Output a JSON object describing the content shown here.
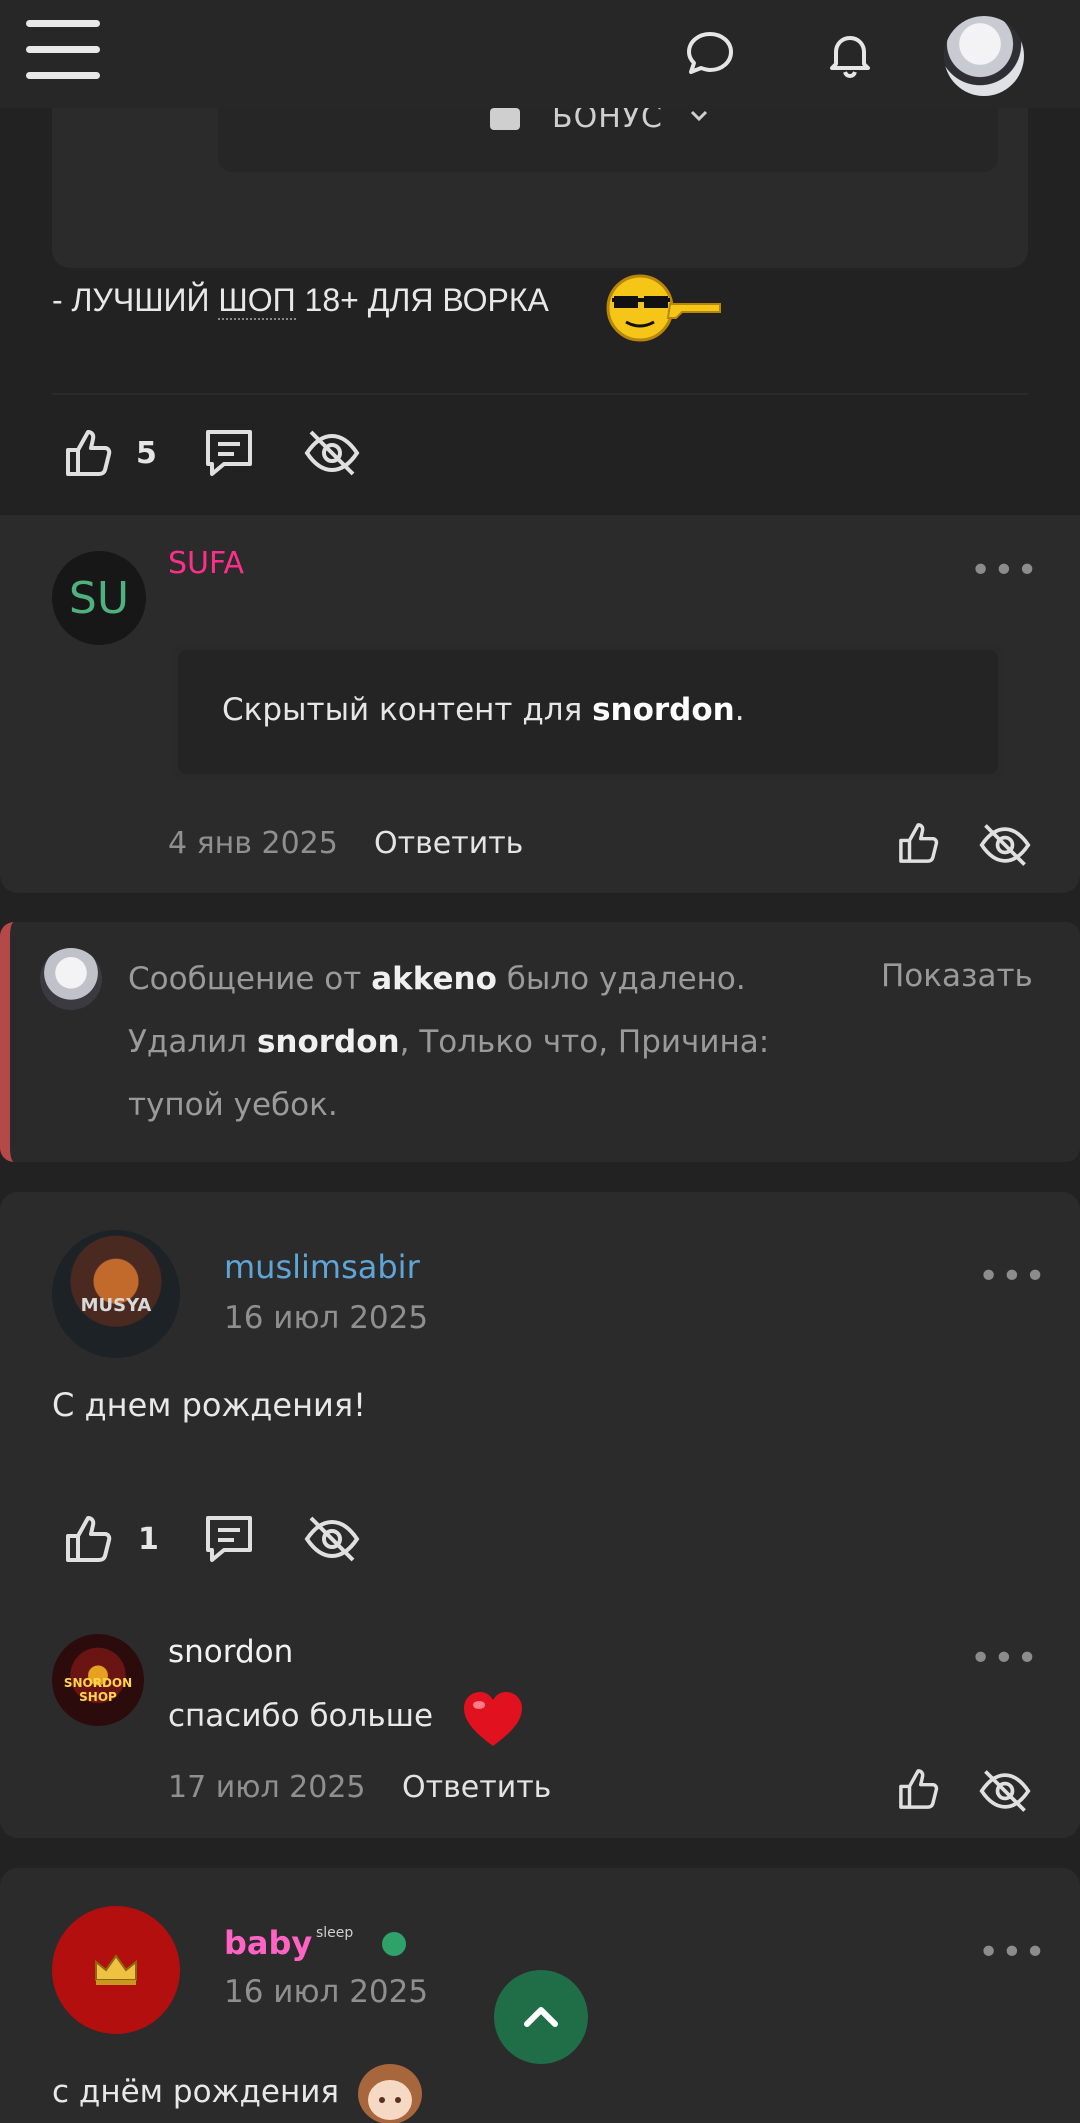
{
  "header": {
    "menu_icon": "hamburger-menu-icon",
    "chat_icon": "chat-bubble-icon",
    "notifications_icon": "bell-icon",
    "avatar": "user-avatar"
  },
  "prev_post": {
    "quote_bonus_label": "БОНУС",
    "text_prefix": "- ЛУЧШИЙ ",
    "text_underlined": "ШОП",
    "text_suffix": " 18+ ДЛЯ ВОРКА",
    "likes": "5"
  },
  "reply_sufa": {
    "avatar_initials": "SU",
    "author": "SUFA",
    "hidden_prefix": "Скрытый контент для ",
    "hidden_user": "snordon",
    "hidden_suffix": ".",
    "date": "4 янв 2025",
    "reply_label": "Ответить"
  },
  "deleted": {
    "prefix": "Сообщение от ",
    "user": "akkeno",
    "mid": " было удалено.",
    "line2_prefix": "Удалил ",
    "by": "snordon",
    "line2_suffix": ", Только что, Причина:",
    "reason": "тупой уебок.",
    "show_label": "Показать"
  },
  "post_muslim": {
    "avatar_text": "MUSYA",
    "author": "muslimsabir",
    "date": "16 июл 2025",
    "text": "С днем рождения!",
    "likes": "1"
  },
  "reply_snordon": {
    "avatar_text_1": "SNORDON",
    "avatar_text_2": "SHOP",
    "author": "snordon",
    "text": "спасибо больше",
    "date": "17 июл 2025",
    "reply_label": "Ответить"
  },
  "post_baby": {
    "author": "baby",
    "status_icon_text": "sleep",
    "date": "16 июл 2025",
    "text": "с днём рождения"
  },
  "colors": {
    "background": "#222222",
    "card": "#2b2b2b",
    "accent_green": "#1f6e48",
    "name_pink": "#ff2e8b",
    "name_blue": "#5fa6d8",
    "deleted_border": "#b54848"
  }
}
